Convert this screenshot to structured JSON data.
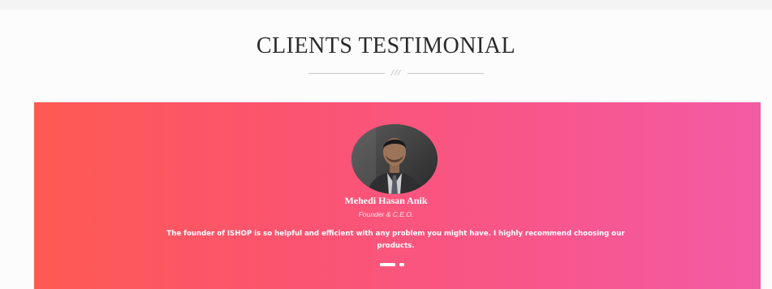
{
  "section": {
    "title": "CLIENTS TESTIMONIAL",
    "divider_glyph": "///"
  },
  "testimonial": {
    "name": "Mehedi Hasan Anik",
    "role": "Founder & C.E.O.",
    "quote": "The founder of ISHOP is so helpful and efficient with any problem you might have. I highly recommend choosing our products.",
    "avatar_icon": "person-photo"
  },
  "carousel": {
    "slide_count": 2,
    "active_index": 0
  },
  "colors": {
    "banner_start": "#fe5a52",
    "banner_end": "#f35ba4",
    "title": "#2b2b2b",
    "text_on_banner": "#ffffff"
  }
}
